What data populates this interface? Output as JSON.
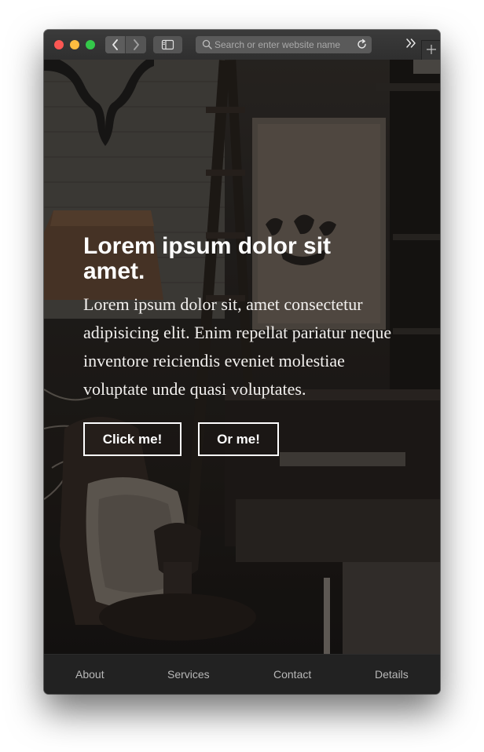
{
  "browser": {
    "address_placeholder": "Search or enter website name",
    "icons": {
      "back": "chevron-left-icon",
      "forward": "chevron-right-icon",
      "sidebar": "sidebar-icon",
      "search": "search-icon",
      "reload": "reload-icon",
      "overflow": "double-chevron-right-icon",
      "new_tab": "plus-icon"
    },
    "traffic_light_colors": {
      "close": "#fc5753",
      "minimize": "#fdbc40",
      "zoom": "#34c84a"
    }
  },
  "hero": {
    "title": "Lorem ipsum dolor sit amet.",
    "text": "Lorem ipsum dolor sit, amet consectetur adipisicing elit. Enim repellat pariatur neque inventore reiciendis eveniet molestiae voluptate unde quasi voluptates.",
    "primary_button": "Click me!",
    "secondary_button": "Or me!"
  },
  "footer": {
    "links": [
      "About",
      "Services",
      "Contact",
      "Details"
    ]
  },
  "colors": {
    "footer_background": "#222222",
    "footer_link": "#b8b8b8",
    "hero_text": "#ffffff"
  }
}
